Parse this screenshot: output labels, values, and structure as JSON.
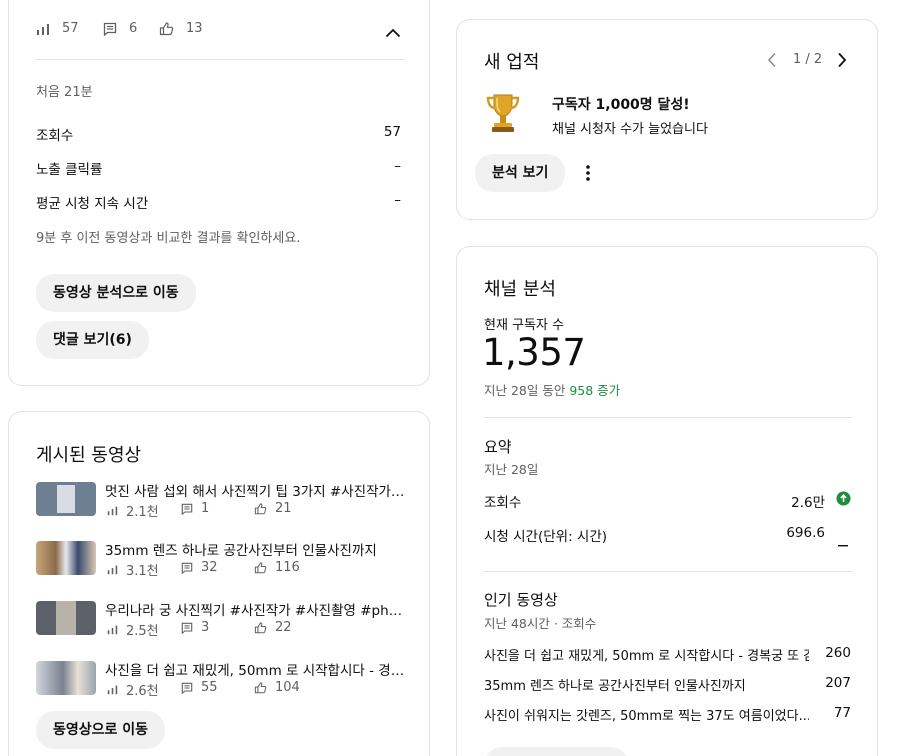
{
  "top_card": {
    "views": "57",
    "comments": "6",
    "likes": "13",
    "period": "처음 21분",
    "rows": [
      {
        "label": "조회수",
        "value": "57"
      },
      {
        "label": "노출 클릭률",
        "value": "–"
      },
      {
        "label": "평균 시청 지속 시간",
        "value": "–"
      }
    ],
    "note": "9분 후 이전 동영상과 비교한 결과를 확인하세요.",
    "analytics_button": "동영상 분석으로 이동",
    "comments_button": "댓글 보기(6)"
  },
  "published": {
    "title": "게시된 동영상",
    "videos": [
      {
        "title": "멋진 사람 섭외 해서 사진찍기 팁 3가지 #사진작가 #s...",
        "views": "2.1천",
        "comments": "1",
        "likes": "21"
      },
      {
        "title": "35mm 렌즈 하나로 공간사진부터 인물사진까지",
        "views": "3.1천",
        "comments": "32",
        "likes": "116"
      },
      {
        "title": "우리나라 궁 사진찍기 #사진작가 #사진촬영 #photo...",
        "views": "2.5천",
        "comments": "3",
        "likes": "22"
      },
      {
        "title": "사진을 더 쉽고 재밌게, 50mm 로 시작합시다 - 경복...",
        "views": "2.6천",
        "comments": "55",
        "likes": "104"
      }
    ],
    "go_button": "동영상으로 이동"
  },
  "achievement": {
    "title": "새 업적",
    "pager": "1 / 2",
    "headline": "구독자 1,000명 달성!",
    "subtext": "채널 시청자 수가 늘었습니다",
    "analytics_button": "분석 보기"
  },
  "channel": {
    "title": "채널 분석",
    "subs_label": "현재 구독자 수",
    "subs_count": "1,357",
    "period_prefix": "지난 28일 동안",
    "period_gain": "958 증가",
    "summary_title": "요약",
    "summary_period": "지난 28일",
    "summary_rows": [
      {
        "label": "조회수",
        "value": "2.6만"
      },
      {
        "label": "시청 시간(단위: 시간)",
        "value": "696.6"
      }
    ],
    "popular_title": "인기 동영상",
    "popular_period": "지난 48시간 · 조회수",
    "popular": [
      {
        "title": "사진을 더 쉽고 재밌게, 50mm 로 시작합시다 - 경복궁 또 감",
        "value": "260"
      },
      {
        "title": "35mm 렌즈 하나로 공간사진부터 인물사진까지",
        "value": "207"
      },
      {
        "title": "사진이 쉬워지는 갓렌즈, 50mm로 찍는 37도 여름이었다......",
        "value": "77"
      }
    ]
  },
  "colors": {
    "accent_green": "#1e8e3e",
    "pill_bg": "#f1f1f1",
    "border": "#e3e3e3"
  }
}
